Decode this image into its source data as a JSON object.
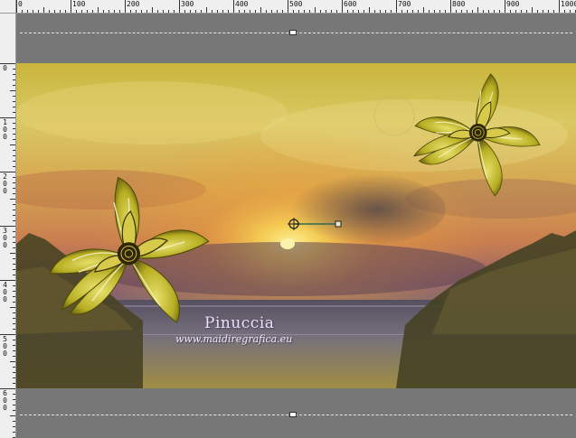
{
  "ruler_top": {
    "labels": [
      "0",
      "100",
      "200",
      "300",
      "400",
      "500",
      "600",
      "700",
      "800",
      "900",
      "1000"
    ]
  },
  "ruler_left": {
    "labels": [
      "0",
      "100",
      "200",
      "300",
      "400",
      "500",
      "600"
    ]
  },
  "image": {
    "watermark_name": "Pinuccia",
    "watermark_url": "www.maidiregrafica.eu"
  },
  "colors": {
    "sky_top": "#c9b640",
    "sun": "#fff6a0",
    "cloud_dark": "#4a3d4e",
    "sea": "#6d6579",
    "flower": "#b7ad22",
    "guide_line": "#e8e8e8",
    "workspace_gray": "#777777"
  },
  "icons": {
    "guide_handle": "guide-handle-icon",
    "rotation_handle": "rotation-handle-icon"
  }
}
